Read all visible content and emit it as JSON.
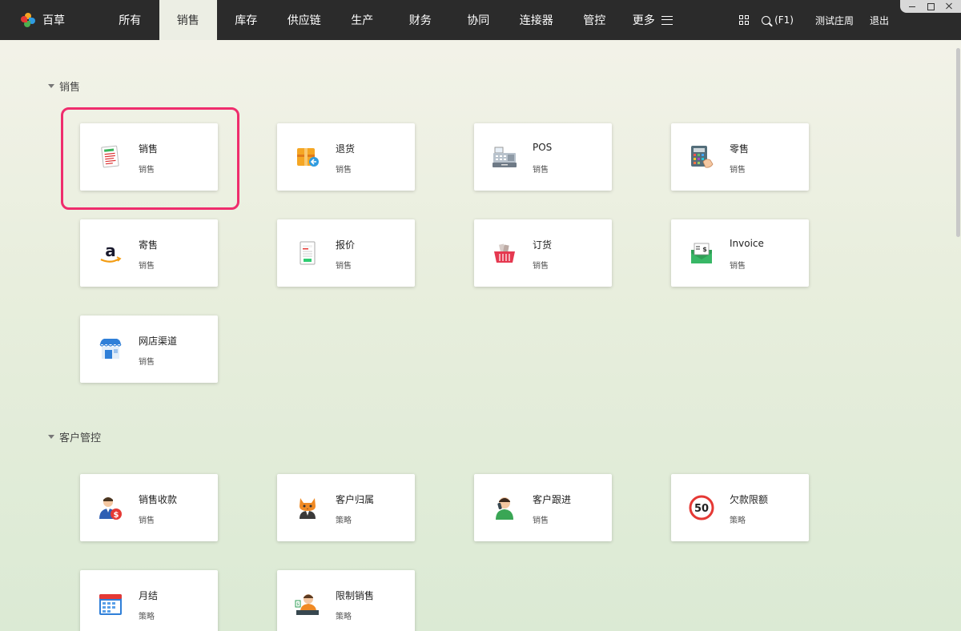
{
  "brand": {
    "name": "百草"
  },
  "nav": {
    "items": [
      "所有",
      "销售",
      "库存",
      "供应链",
      "生产",
      "财务",
      "协同",
      "连接器",
      "管控"
    ],
    "more_label": "更多",
    "active": "销售"
  },
  "toolbar": {
    "search_label": "(F1)",
    "user_name": "测试庄周",
    "logout_label": "退出"
  },
  "sections": [
    {
      "title": "销售",
      "cards": [
        {
          "title": "销售",
          "subtitle": "销售",
          "icon": "sales-document-icon"
        },
        {
          "title": "退货",
          "subtitle": "销售",
          "icon": "return-box-icon"
        },
        {
          "title": "POS",
          "subtitle": "销售",
          "icon": "cash-register-icon"
        },
        {
          "title": "零售",
          "subtitle": "销售",
          "icon": "retail-calculator-icon"
        },
        {
          "title": "寄售",
          "subtitle": "销售",
          "icon": "amazon-icon"
        },
        {
          "title": "报价",
          "subtitle": "销售",
          "icon": "quote-receipt-icon"
        },
        {
          "title": "订货",
          "subtitle": "销售",
          "icon": "shopping-basket-icon"
        },
        {
          "title": "Invoice",
          "subtitle": "销售",
          "icon": "invoice-envelope-icon"
        },
        {
          "title": "网店渠道",
          "subtitle": "销售",
          "icon": "online-store-icon"
        }
      ]
    },
    {
      "title": "客户管控",
      "cards": [
        {
          "title": "销售收款",
          "subtitle": "销售",
          "icon": "payment-collector-icon"
        },
        {
          "title": "客户归属",
          "subtitle": "策略",
          "icon": "cat-customer-icon"
        },
        {
          "title": "客户跟进",
          "subtitle": "销售",
          "icon": "phone-followup-icon"
        },
        {
          "title": "欠款限额",
          "subtitle": "策略",
          "icon": "limit-sign-icon",
          "limit_value": "50"
        },
        {
          "title": "月结",
          "subtitle": "策略",
          "icon": "calendar-icon"
        },
        {
          "title": "限制销售",
          "subtitle": "策略",
          "icon": "seller-desk-icon"
        }
      ]
    }
  ],
  "colors": {
    "topbar": "#2b2b2b",
    "active_tab": "#eceee4",
    "highlight": "#ef2d6d"
  }
}
